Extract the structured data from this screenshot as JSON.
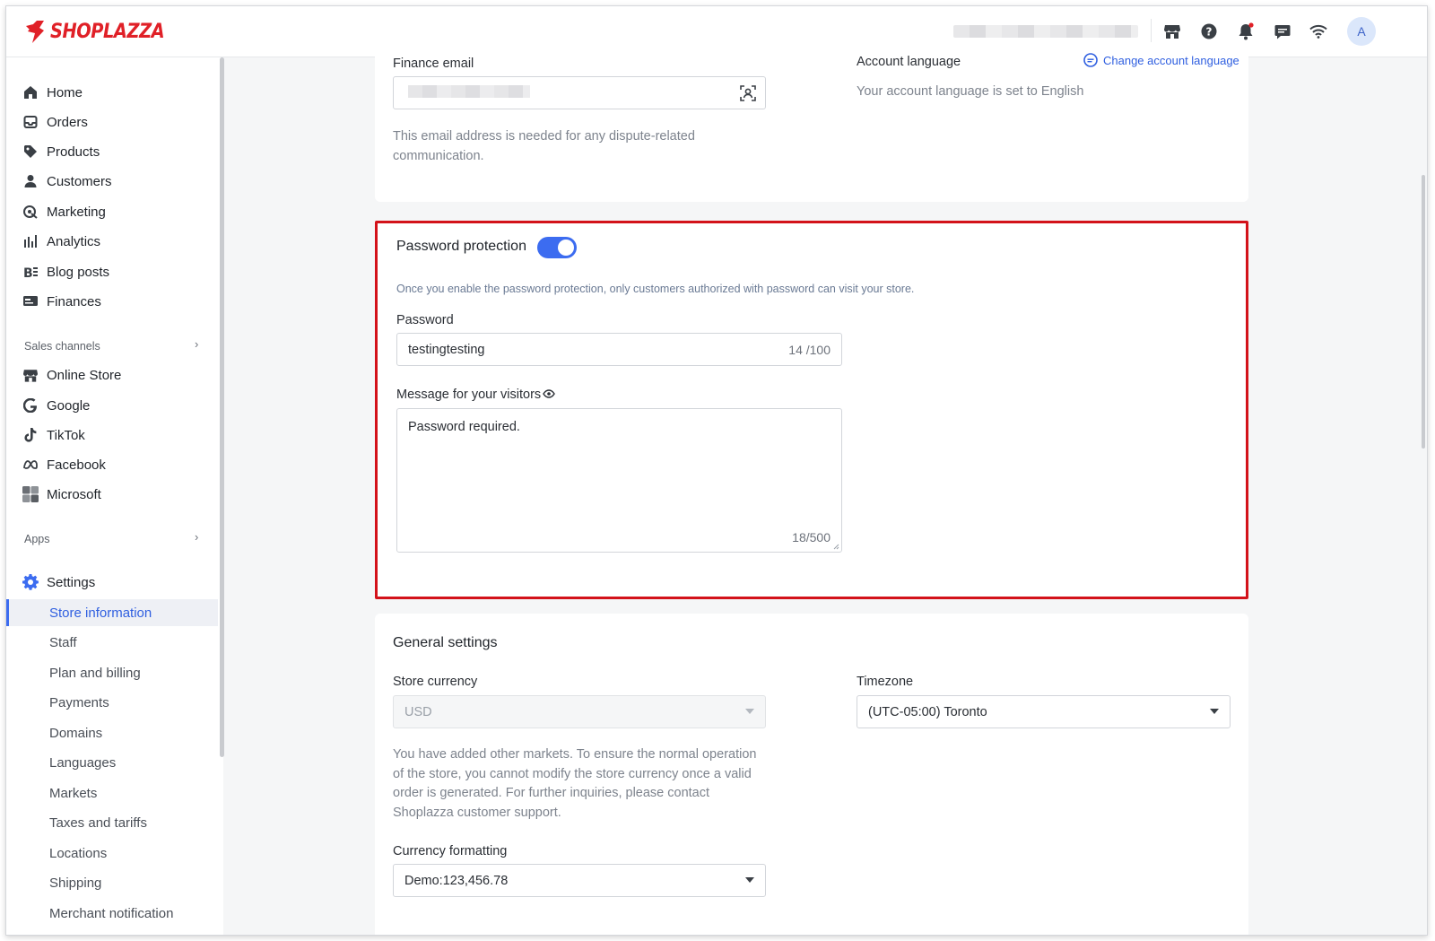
{
  "brand": {
    "name": "SHOPLAZZA",
    "color": "#e02027",
    "accent": "#3c6cf0",
    "highlight_border": "#d3121a"
  },
  "topbar": {
    "icons": [
      "store-icon",
      "help-icon",
      "bell-icon",
      "chat-icon",
      "wifi-icon"
    ],
    "avatar_initial": "A"
  },
  "sidebar": {
    "main_items": [
      {
        "label": "Home",
        "icon": "home-icon"
      },
      {
        "label": "Orders",
        "icon": "orders-icon"
      },
      {
        "label": "Products",
        "icon": "tag-icon"
      },
      {
        "label": "Customers",
        "icon": "person-icon"
      },
      {
        "label": "Marketing",
        "icon": "marketing-icon"
      },
      {
        "label": "Analytics",
        "icon": "bar-chart-icon"
      },
      {
        "label": "Blog posts",
        "icon": "blog-icon"
      },
      {
        "label": "Finances",
        "icon": "finances-icon"
      }
    ],
    "sales_channels_label": "Sales channels",
    "sales_channels": [
      {
        "label": "Online Store",
        "icon": "store-icon"
      },
      {
        "label": "Google",
        "icon": "google-icon"
      },
      {
        "label": "TikTok",
        "icon": "tiktok-icon"
      },
      {
        "label": "Facebook",
        "icon": "meta-icon"
      },
      {
        "label": "Microsoft",
        "icon": "microsoft-icon"
      }
    ],
    "apps_label": "Apps",
    "settings_label": "Settings",
    "settings_items": [
      "Store information",
      "Staff",
      "Plan and billing",
      "Payments",
      "Domains",
      "Languages",
      "Markets",
      "Taxes and tariffs",
      "Locations",
      "Shipping",
      "Merchant notification"
    ],
    "active_settings_item": "Store information"
  },
  "account": {
    "finance_email_label": "Finance email",
    "finance_email_helper": "This email address is needed for any dispute-related communication.",
    "account_language_label": "Account language",
    "change_language_link": "Change account language",
    "account_language_text": "Your account language is set to English"
  },
  "password_protection": {
    "title": "Password protection",
    "enabled": true,
    "description": "Once you enable the password protection, only customers authorized with password can visit your store.",
    "password_label": "Password",
    "password_value": "testingtesting",
    "password_counter": "14 /100",
    "message_label": "Message for your visitors",
    "message_value": "Password required.",
    "message_counter": "18/500"
  },
  "general_settings": {
    "title": "General settings",
    "store_currency_label": "Store currency",
    "store_currency_value": "USD",
    "store_currency_helper": "You have added other markets. To ensure the normal operation of the store, you cannot modify the store currency once a valid order is generated. For further inquiries, please contact Shoplazza customer support.",
    "timezone_label": "Timezone",
    "timezone_value": "(UTC-05:00) Toronto",
    "currency_formatting_label": "Currency formatting",
    "currency_formatting_value": "Demo:123,456.78"
  }
}
